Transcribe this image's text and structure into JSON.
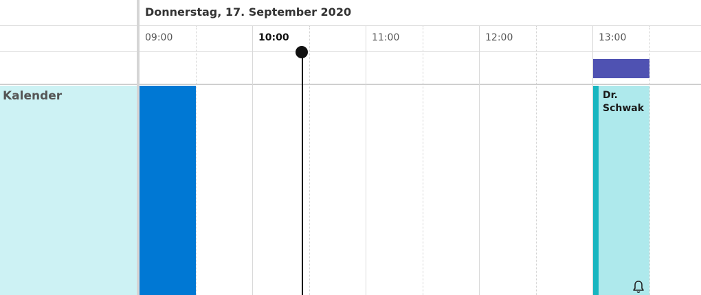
{
  "header": {
    "date_title": "Donnerstag, 17. September 2020"
  },
  "timeline": {
    "hours": [
      {
        "label": "09:00",
        "current": false
      },
      {
        "label": "10:00",
        "current": true
      },
      {
        "label": "11:00",
        "current": false
      },
      {
        "label": "12:00",
        "current": false
      },
      {
        "label": "13:00",
        "current": false
      }
    ]
  },
  "calendar": {
    "name": "Kalender"
  },
  "events": {
    "teal_title": "Dr. Schwak",
    "icons": {
      "reminder": "bell-icon"
    }
  },
  "colors": {
    "calendar_bg": "#cdf2f4",
    "event_blue": "#0078d4",
    "event_allday": "#4f52b2",
    "event_teal_bg": "#aee9ec",
    "event_teal_accent": "#18b6c0",
    "now_indicator": "#111111"
  }
}
